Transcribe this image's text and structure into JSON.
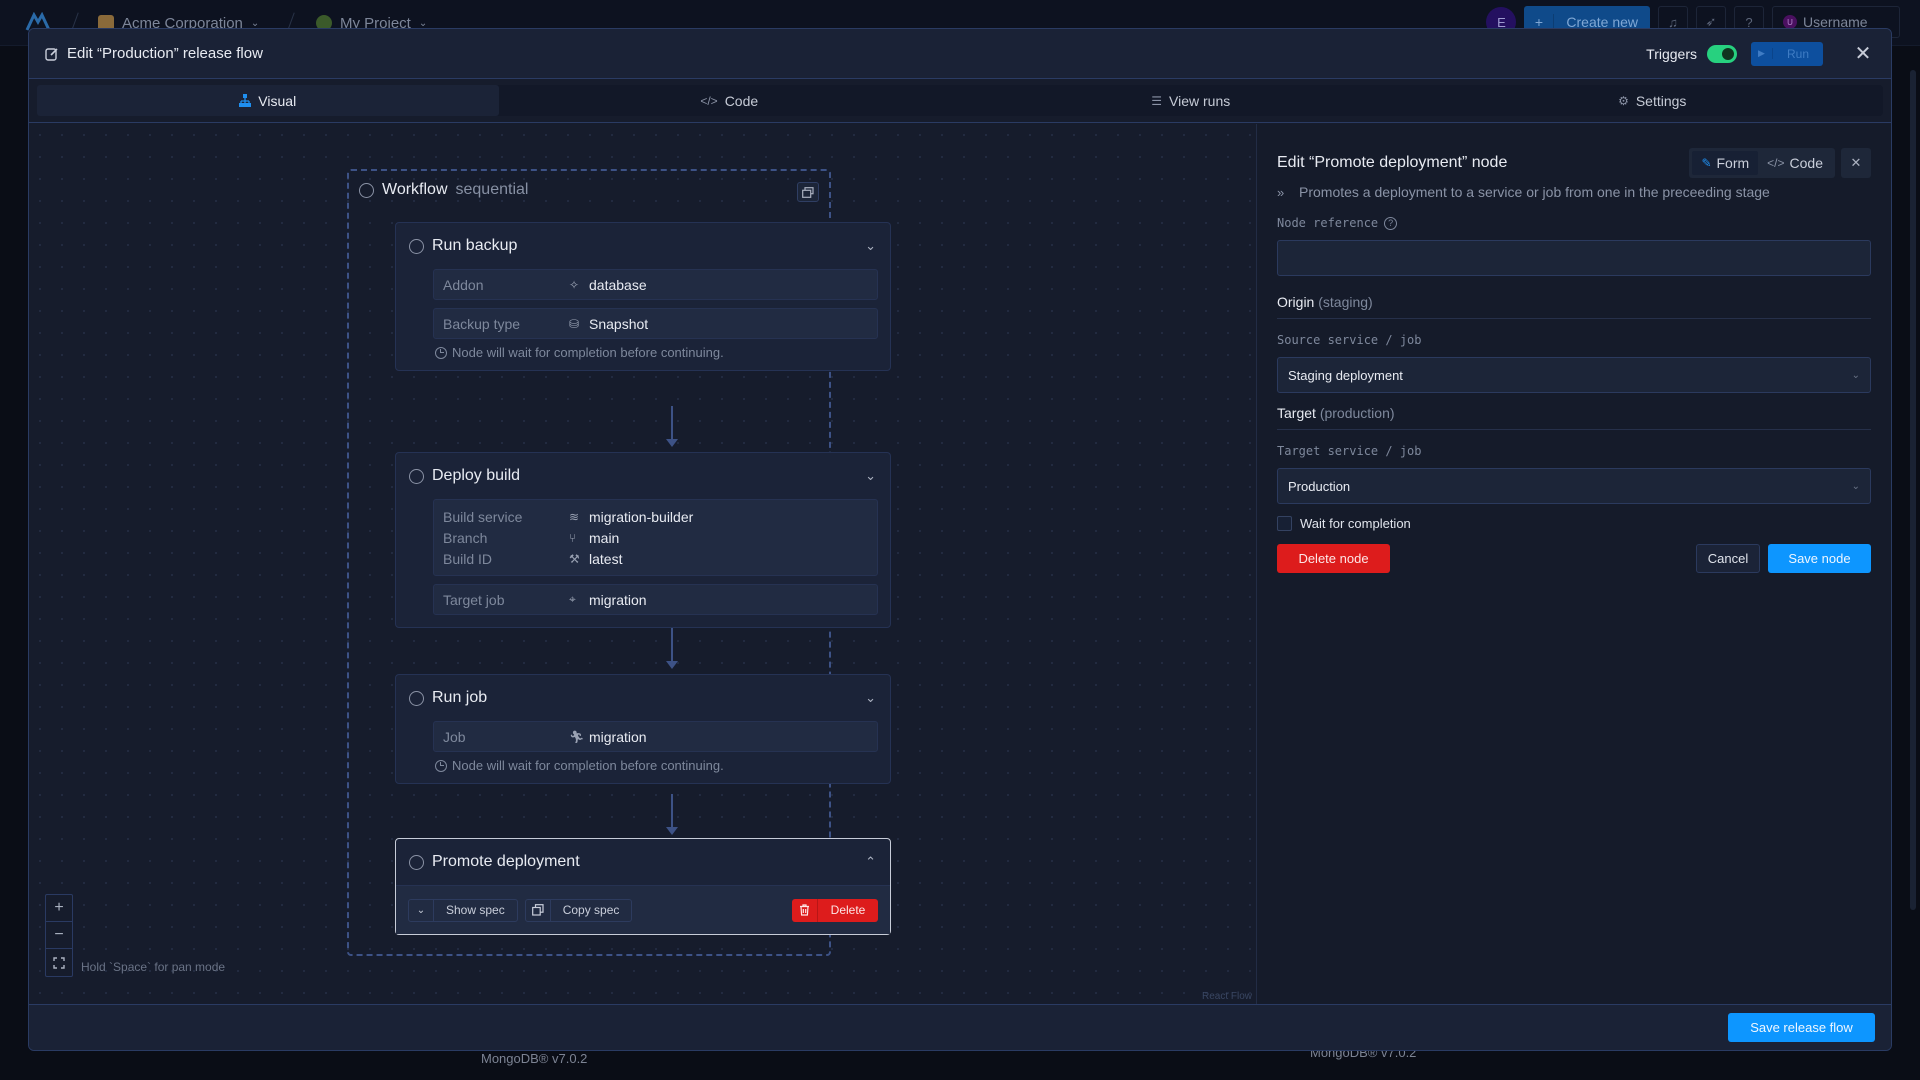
{
  "background": {
    "org": "Acme Corporation",
    "project": "My Project",
    "avatar_letter": "E",
    "create_new": "Create new",
    "user_initial": "U",
    "username": "Username",
    "addon_versions": [
      "MongoDB® v7.0.2",
      "MongoDB® v7.0.2"
    ]
  },
  "modal": {
    "title": "Edit “Production” release flow",
    "triggers_label": "Triggers",
    "triggers_enabled": true,
    "run_label": "Run",
    "tabs": [
      {
        "label": "Visual",
        "icon": "sitemap-icon",
        "active": true
      },
      {
        "label": "Code",
        "icon": "code-icon",
        "active": false
      },
      {
        "label": "View runs",
        "icon": "list-icon",
        "active": false
      },
      {
        "label": "Settings",
        "icon": "gear-icon",
        "active": false
      }
    ],
    "save_label": "Save release flow"
  },
  "canvas": {
    "workflow": {
      "label": "Workflow",
      "mode": "sequential"
    },
    "nodes": [
      {
        "title": "Run backup",
        "props": [
          {
            "key": "Addon",
            "icon": "puzzle-icon",
            "value": "database"
          },
          {
            "key": "Backup type",
            "icon": "database-icon",
            "value": "Snapshot"
          }
        ],
        "note": "Node will wait for completion before continuing."
      },
      {
        "title": "Deploy build",
        "props": [
          {
            "key": "Build service",
            "icon": "layers-icon",
            "value": "migration-builder"
          },
          {
            "key": "Branch",
            "icon": "git-branch-icon",
            "value": "main"
          },
          {
            "key": "Build ID",
            "icon": "wrench-icon",
            "value": "latest"
          },
          {
            "key": "Target job",
            "icon": "target-icon",
            "value": "migration"
          }
        ]
      },
      {
        "title": "Run job",
        "props": [
          {
            "key": "Job",
            "icon": "running-icon",
            "value": "migration"
          }
        ],
        "note": "Node will wait for completion before continuing."
      },
      {
        "title": "Promote deployment",
        "selected": true,
        "show_spec": "Show spec",
        "copy_spec": "Copy spec",
        "delete": "Delete"
      }
    ],
    "pan_hint": "Hold `Space` for pan mode",
    "attribution": "React Flow"
  },
  "panel": {
    "title": "Edit “Promote deployment” node",
    "mode_form": "Form",
    "mode_code": "Code",
    "description": "Promotes a deployment to a service or job from one in the preceeding stage",
    "node_reference_label": "Node reference",
    "node_reference_value": "",
    "origin_title": "Origin",
    "origin_sub": "(staging)",
    "source_label": "Source service / job",
    "source_value": "Staging deployment",
    "target_title": "Target",
    "target_sub": "(production)",
    "target_label": "Target service / job",
    "target_value": "Production",
    "wait_label": "Wait for completion",
    "wait_checked": false,
    "delete_label": "Delete node",
    "cancel_label": "Cancel",
    "save_label": "Save node"
  }
}
